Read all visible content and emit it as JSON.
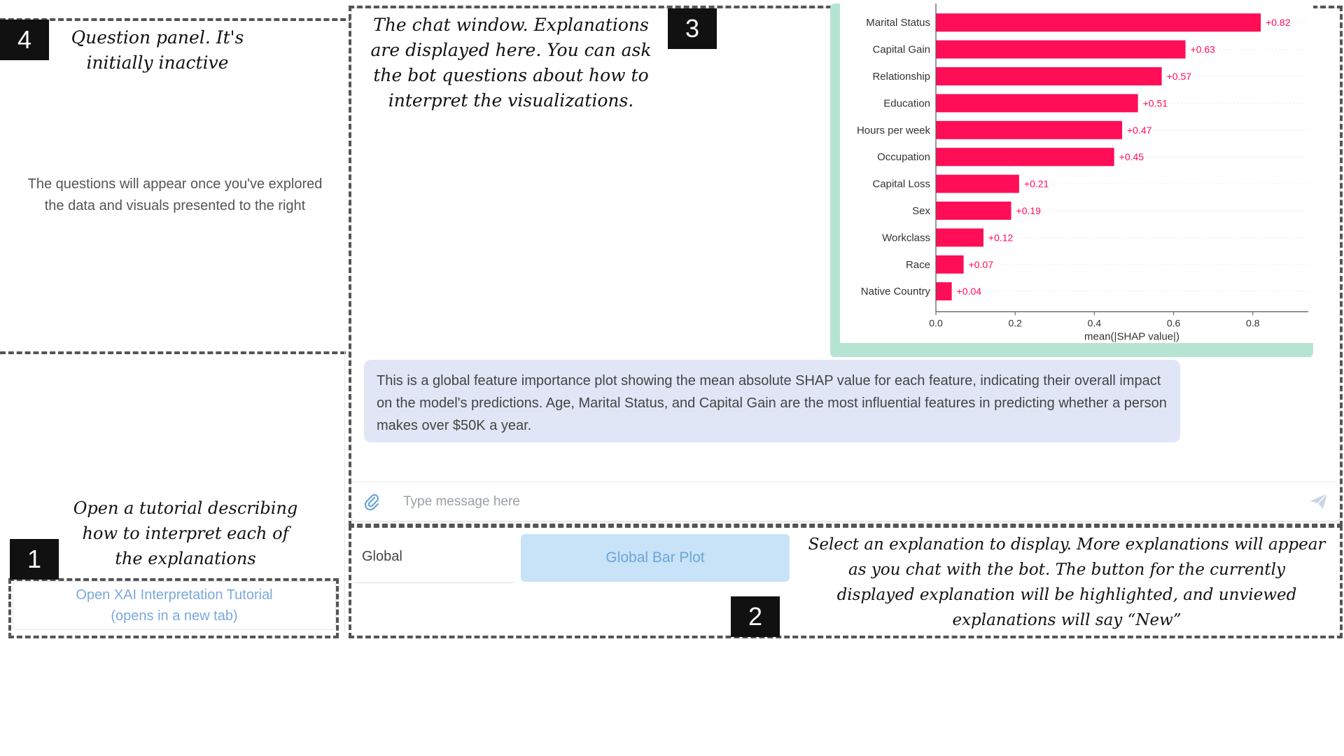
{
  "annotations": {
    "a1": {
      "badge": "1",
      "lines": [
        "Open a tutorial describing",
        "how to interpret each of",
        "the explanations"
      ]
    },
    "a2": {
      "badge": "2",
      "lines": [
        "Select an explanation to display. More explanations will appear",
        "as you chat with the bot. The button for the currently",
        "displayed explanation will be highlighted, and unviewed",
        "explanations will say “New”"
      ]
    },
    "a3": {
      "badge": "3",
      "lines": [
        "The chat window. Explanations",
        "are displayed here. You can ask",
        "the bot questions about how to",
        "interpret the visualizations."
      ]
    },
    "a4": {
      "badge": "4",
      "lines": [
        "Question panel. It's",
        "initially inactive"
      ]
    }
  },
  "question_panel": {
    "line1": "The questions will appear once you've explored",
    "line2": "the data and visuals presented to the right"
  },
  "chat": {
    "bot_message": "This is a global feature importance plot showing the mean absolute SHAP value for each feature, indicating their overall impact on the model's predictions. Age, Marital Status, and Capital Gain are the most influential features in predicting whether a person makes over $50K a year.",
    "input_placeholder": "Type message here",
    "icons": {
      "attach": "paperclip-icon",
      "send": "send-icon"
    },
    "colors": {
      "bubble": "#e0e6f5",
      "chart_frame": "#b5e4d2",
      "bar": "#ff0d57"
    }
  },
  "chart_data": {
    "type": "bar",
    "orientation": "horizontal",
    "categories": [
      "Marital Status",
      "Capital Gain",
      "Relationship",
      "Education",
      "Hours per week",
      "Occupation",
      "Capital Loss",
      "Sex",
      "Workclass",
      "Race",
      "Native Country"
    ],
    "values": [
      0.82,
      0.63,
      0.57,
      0.51,
      0.47,
      0.45,
      0.21,
      0.19,
      0.12,
      0.07,
      0.04
    ],
    "labels": [
      "+0.82",
      "+0.63",
      "+0.57",
      "+0.51",
      "+0.47",
      "+0.45",
      "+0.21",
      "+0.19",
      "+0.12",
      "+0.07",
      "+0.04"
    ],
    "xlabel": "mean(|SHAP value|)",
    "xticks": [
      "0.0",
      "0.2",
      "0.4",
      "0.6",
      "0.8"
    ],
    "xlim": [
      0,
      0.94
    ],
    "grid": false
  },
  "explanations": {
    "category": "Global",
    "button_label": "Global Bar Plot"
  },
  "tutorial": {
    "line1": "Open XAI Interpretation Tutorial",
    "line2": "(opens in a new tab)"
  }
}
